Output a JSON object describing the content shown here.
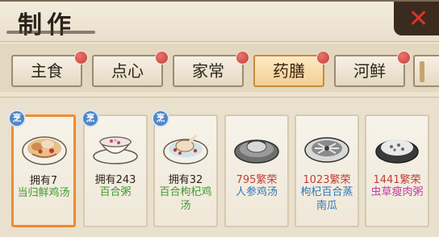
{
  "window": {
    "title": "制作",
    "close_symbol": "✕"
  },
  "tabs": [
    {
      "label": "主食",
      "active": false
    },
    {
      "label": "点心",
      "active": false
    },
    {
      "label": "家常",
      "active": false
    },
    {
      "label": "药膳",
      "active": true
    },
    {
      "label": "河鲜",
      "active": false
    }
  ],
  "recipes": [
    {
      "badge": "烹",
      "owned": "拥有7",
      "name": "当归鲜鸡汤",
      "name_color": "green",
      "selected": true,
      "icon": "chicken-soup-icon"
    },
    {
      "badge": "烹",
      "owned": "拥有243",
      "name": "百合粥",
      "name_color": "green",
      "selected": false,
      "icon": "lily-porridge-icon"
    },
    {
      "badge": "烹",
      "owned": "拥有32",
      "name": "百合枸杞鸡汤",
      "name_color": "green",
      "selected": false,
      "icon": "goji-chicken-soup-icon"
    },
    {
      "badge": "",
      "owned": "795繁荣",
      "name": "人参鸡汤",
      "name_color": "blue",
      "selected": false,
      "icon": "ginseng-chicken-soup-icon"
    },
    {
      "badge": "",
      "owned": "1023繁荣",
      "name": "枸杞百合蒸南瓜",
      "name_color": "blue",
      "selected": false,
      "icon": "steamed-pumpkin-icon"
    },
    {
      "badge": "",
      "owned": "1441繁荣",
      "name": "虫草瘦肉粥",
      "name_color": "pink",
      "selected": false,
      "icon": "cordyceps-porridge-icon"
    }
  ],
  "colors": {
    "accent_selected": "#ef8b2e",
    "green_name": "#3f9a2e",
    "blue_name": "#2f78b8",
    "pink_name": "#c43ba1",
    "prosperity_red": "#c2403a",
    "badge_blue": "#4f86c6"
  }
}
